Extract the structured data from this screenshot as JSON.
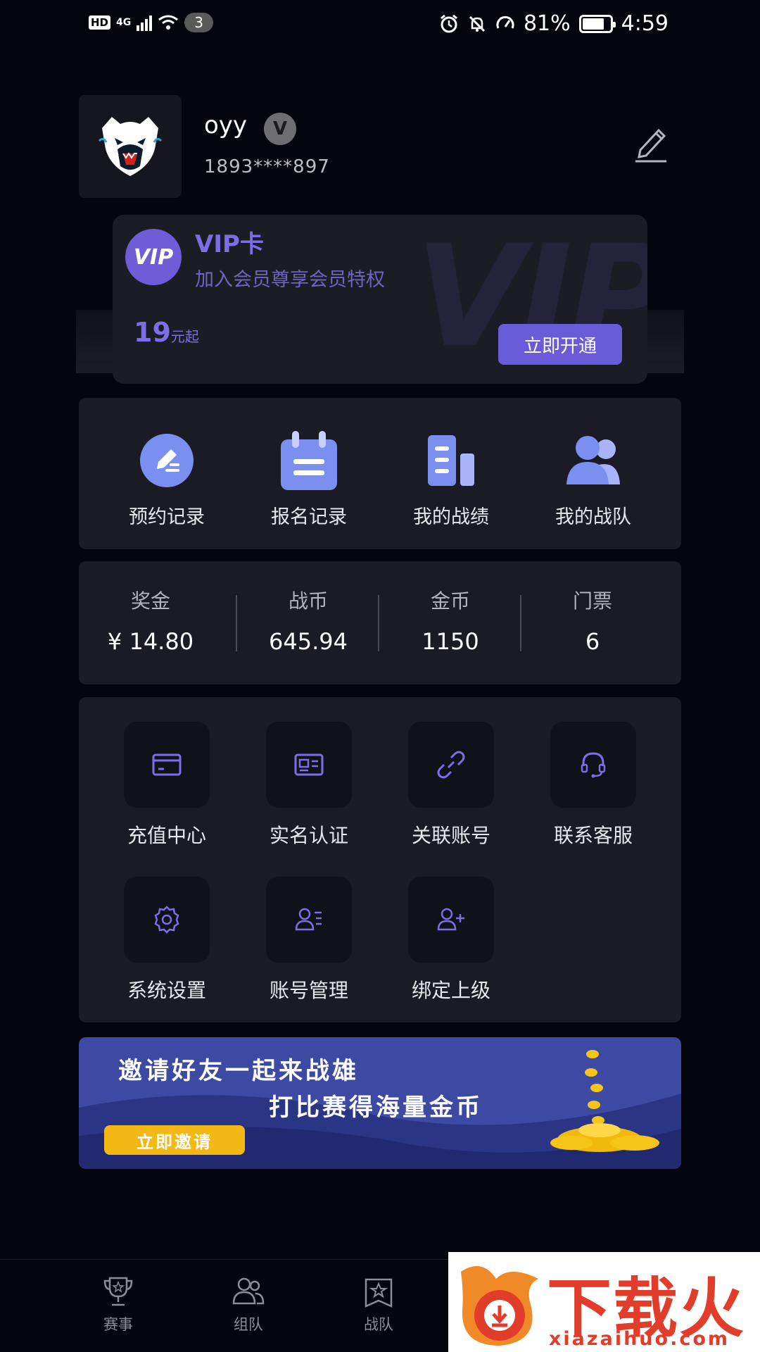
{
  "status_bar": {
    "hd": "HD",
    "network": "4G",
    "notification_count": "3",
    "battery": "81%",
    "battery_level": 0.81,
    "time": "4:59"
  },
  "profile": {
    "username": "oyy",
    "badge": "V",
    "phone": "1893****897"
  },
  "vip": {
    "title": "VIP卡",
    "subtitle": "加入会员尊享会员特权",
    "watermark": "VIP",
    "price": "19",
    "price_unit": "元起",
    "button": "立即开通",
    "logo_text": "VIP"
  },
  "quick_actions": [
    {
      "label": "预约记录",
      "icon": "pen-icon"
    },
    {
      "label": "报名记录",
      "icon": "calendar-icon"
    },
    {
      "label": "我的战绩",
      "icon": "stats-icon"
    },
    {
      "label": "我的战队",
      "icon": "team-icon"
    }
  ],
  "stats": [
    {
      "label": "奖金",
      "value": "¥ 14.80"
    },
    {
      "label": "战币",
      "value": "645.94"
    },
    {
      "label": "金币",
      "value": "1150"
    },
    {
      "label": "门票",
      "value": "6"
    }
  ],
  "tools": [
    {
      "label": "充值中心",
      "icon": "card-icon"
    },
    {
      "label": "实名认证",
      "icon": "id-card-icon"
    },
    {
      "label": "关联账号",
      "icon": "link-icon"
    },
    {
      "label": "联系客服",
      "icon": "headset-icon"
    },
    {
      "label": "系统设置",
      "icon": "gear-icon"
    },
    {
      "label": "账号管理",
      "icon": "user-list-icon"
    },
    {
      "label": "绑定上级",
      "icon": "user-add-icon"
    }
  ],
  "invite": {
    "line1": "邀请好友一起来战雄",
    "line2": "打比赛得海量金币",
    "button": "立即邀请"
  },
  "bottom_nav": [
    {
      "label": "赛事",
      "icon": "trophy-icon"
    },
    {
      "label": "组队",
      "icon": "group-icon"
    },
    {
      "label": "战队",
      "icon": "team-star-icon"
    }
  ],
  "watermark": {
    "text": "下载火",
    "url": "xiazaihuo.com"
  },
  "colors": {
    "background": "#04050d",
    "panel": "#1a1b25",
    "accent": "#6a5bd9",
    "icon_blue": "#7b8ff0"
  }
}
